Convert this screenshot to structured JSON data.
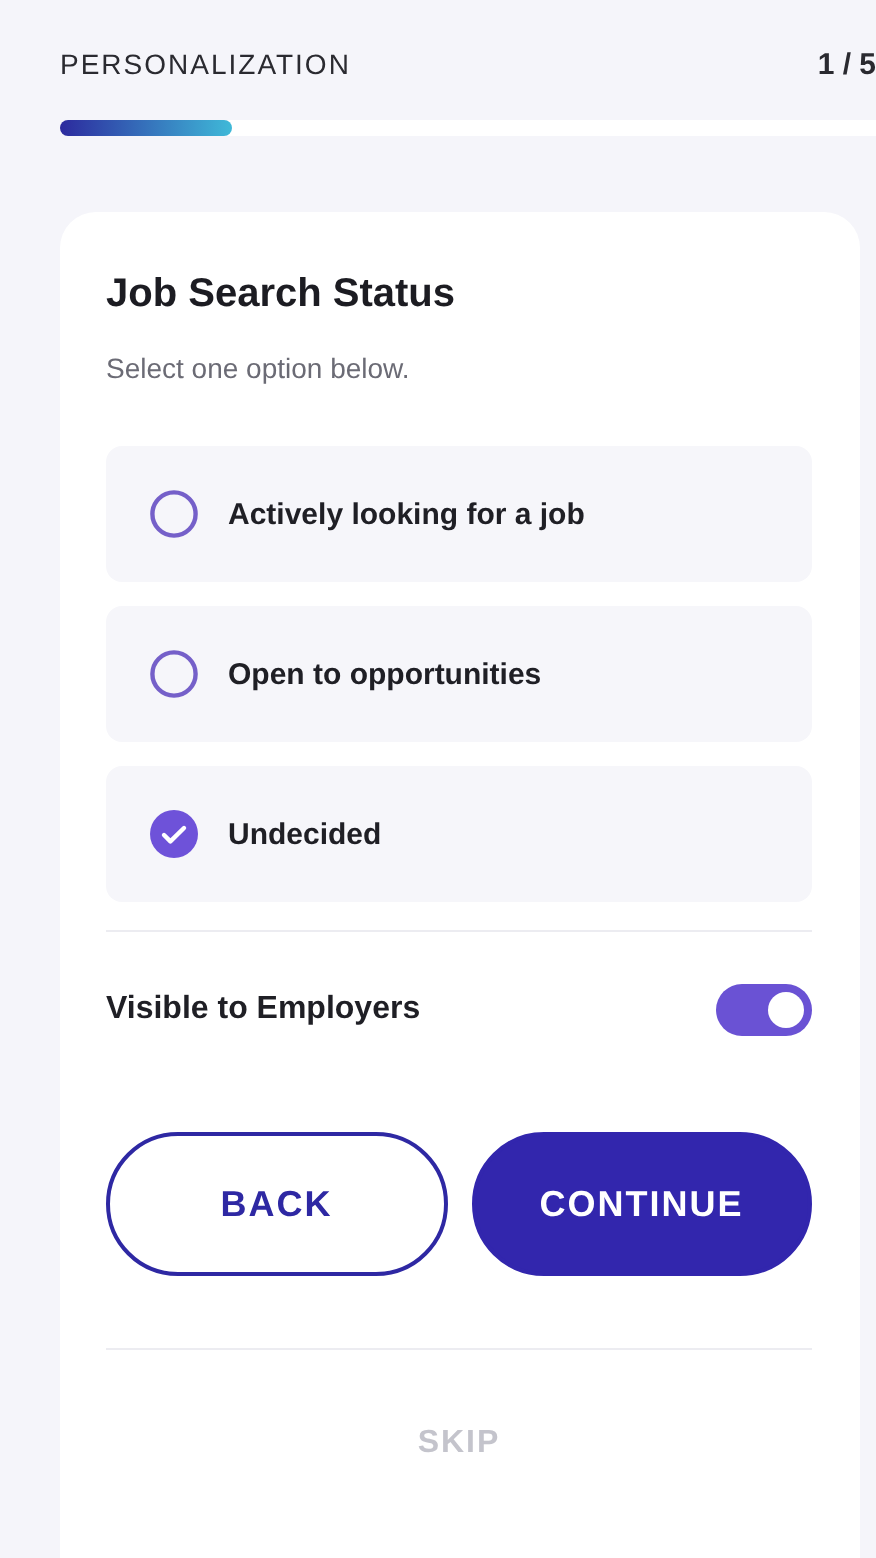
{
  "header": {
    "title": "PERSONALIZATION",
    "step": "1 / 5",
    "progress": {
      "level": 0.21
    }
  },
  "card": {
    "title": "Job Search Status",
    "subtitle": "Select one option below.",
    "options": [
      {
        "label": "Actively looking for a job",
        "selected": false
      },
      {
        "label": "Open to opportunities",
        "selected": false
      },
      {
        "label": "Undecided",
        "selected": true
      }
    ],
    "visibility": {
      "label": "Visible to Employers",
      "on": true
    },
    "buttons": [
      {
        "label": "BACK",
        "kind": "outline"
      },
      {
        "label": "CONTINUE",
        "kind": "primary"
      }
    ],
    "skip": "SKIP"
  }
}
